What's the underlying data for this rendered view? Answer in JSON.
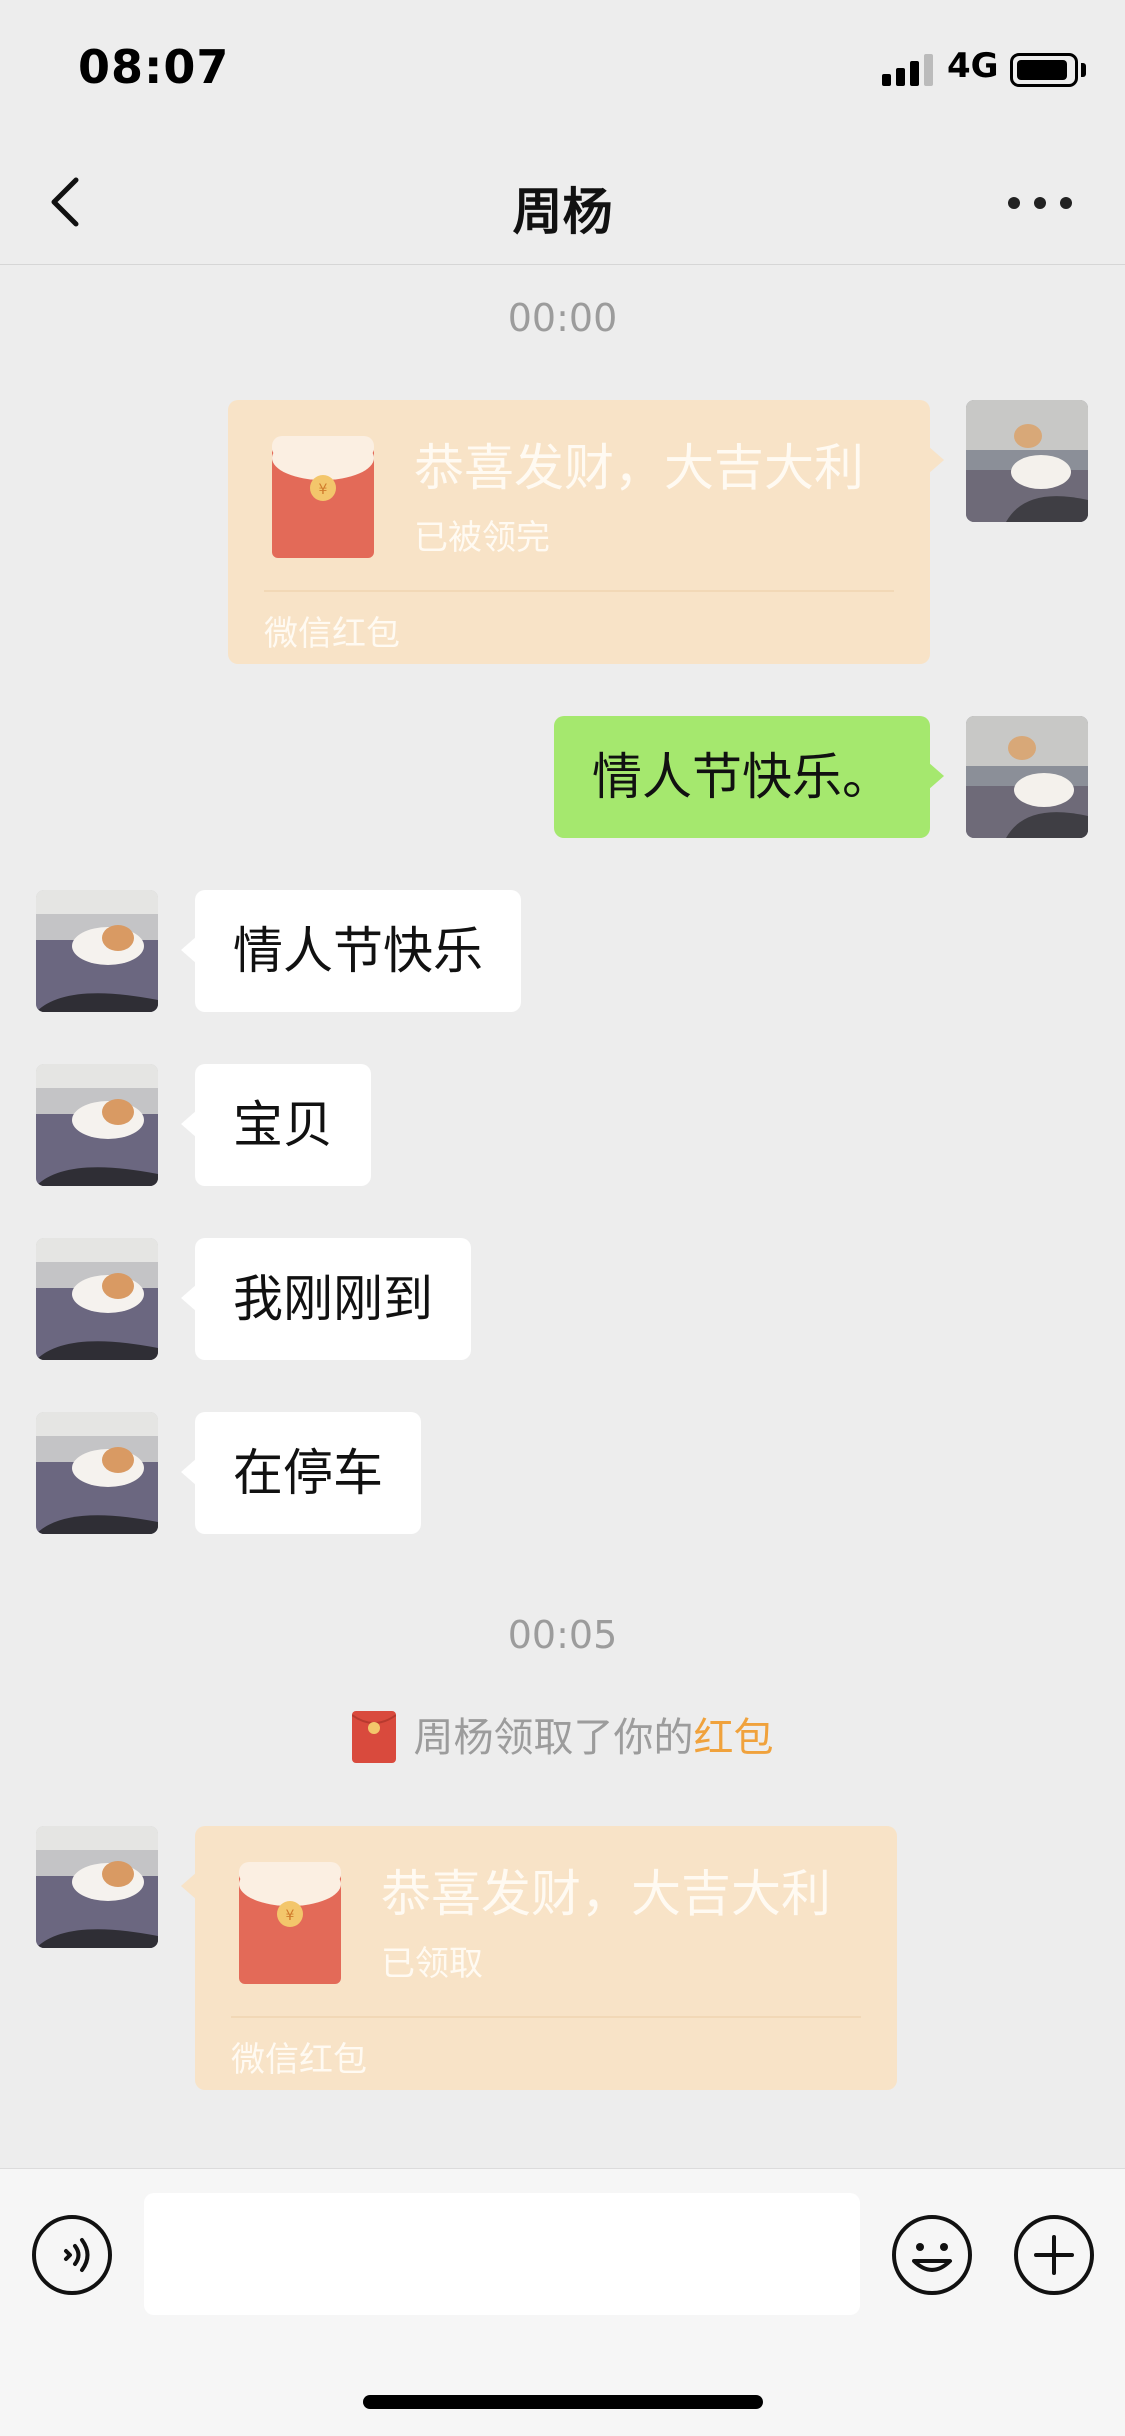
{
  "status_bar": {
    "time": "08:07",
    "network": "4G"
  },
  "nav": {
    "title": "周杨"
  },
  "messages": {
    "timestamp_1": "00:00",
    "redpacket_1": {
      "title": "恭喜发财，大吉大利",
      "status": "已被领完",
      "footer": "微信红包"
    },
    "out_text_1": "情人节快乐。",
    "in_text_1": "情人节快乐",
    "in_text_2": "宝贝",
    "in_text_3": "我刚刚到",
    "in_text_4": "在停车",
    "timestamp_2": "00:05",
    "system_notice": {
      "prefix": "周杨领取了你的",
      "link": "红包"
    },
    "redpacket_2": {
      "title": "恭喜发财，大吉大利",
      "status": "已领取",
      "footer": "微信红包"
    }
  },
  "input_bar": {
    "placeholder": ""
  },
  "colors": {
    "background": "#ededed",
    "sent_bubble": "#a5e86e",
    "received_bubble": "#ffffff",
    "redpacket_bg": "#f8e3c7",
    "redpacket_red": "#e36a58",
    "link": "#f0a23c"
  },
  "icons": [
    "back-arrow-icon",
    "more-icon",
    "voice-icon",
    "emoji-icon",
    "plus-icon",
    "red-envelope-icon"
  ]
}
